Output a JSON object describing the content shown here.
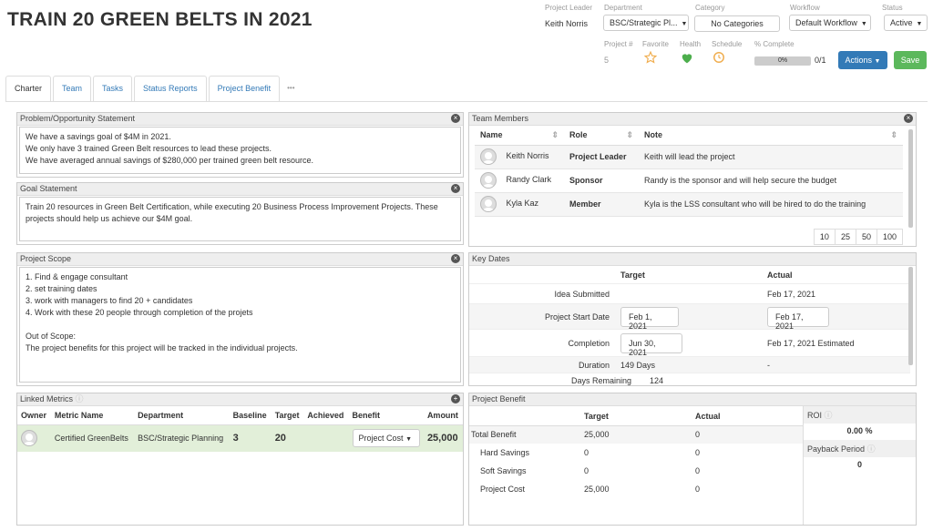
{
  "page": {
    "title": "TRAIN 20 GREEN BELTS IN 2021"
  },
  "header": {
    "project_leader_label": "Project Leader",
    "project_leader": "Keith Norris",
    "department_label": "Department",
    "department": "BSC/Strategic Pl...",
    "category_label": "Category",
    "category": "No Categories",
    "workflow_label": "Workflow",
    "workflow": "Default Workflow",
    "status_label": "Status",
    "status": "Active",
    "project_num_label": "Project #",
    "project_num": "5",
    "favorite_label": "Favorite",
    "health_label": "Health",
    "schedule_label": "Schedule",
    "pct_complete_label": "% Complete",
    "pct_complete": "0%",
    "pct_complete_value": 0,
    "tasks_count": "0/1",
    "actions_label": "Actions",
    "save_label": "Save",
    "colors": {
      "health": "#4cae4c",
      "schedule": "#f0ad4e",
      "favorite": "#f0ad4e",
      "actions": "#337ab7",
      "save": "#5cb85c"
    }
  },
  "tabs": [
    {
      "label": "Charter",
      "active": true
    },
    {
      "label": "Team"
    },
    {
      "label": "Tasks"
    },
    {
      "label": "Status Reports"
    },
    {
      "label": "Project Benefit"
    },
    {
      "label": "•••"
    }
  ],
  "problem": {
    "title": "Problem/Opportunity Statement",
    "lines": [
      "We have a savings goal of $4M in 2021.",
      "We only have 3 trained Green Belt resources to lead these projects.",
      "We have averaged annual savings of $280,000 per trained green belt resource."
    ]
  },
  "goal": {
    "title": "Goal Statement",
    "lines": [
      "Train 20 resources in Green Belt Certification, while executing 20 Business Process Improvement Projects.  These",
      "projects should help us achieve our $4M goal."
    ]
  },
  "scope": {
    "title": "Project Scope",
    "lines": [
      "1. Find & engage consultant",
      "2. set training dates",
      "3. work with managers to find 20 + candidates",
      "4. Work with these 20 people through completion of the projets",
      "",
      "Out of Scope:",
      "The project benefits for this project will be tracked in the individual projects."
    ]
  },
  "team": {
    "title": "Team Members",
    "headers": {
      "name": "Name",
      "role": "Role",
      "note": "Note"
    },
    "rows": [
      {
        "name": "Keith Norris",
        "role": "Project Leader",
        "note": "Keith will lead the project"
      },
      {
        "name": "Randy Clark",
        "role": "Sponsor",
        "note": "Randy is the sponsor and will help secure the budget"
      },
      {
        "name": "Kyla Kaz",
        "role": "Member",
        "note": "Kyla is the LSS consultant who will be hired to do the training"
      }
    ],
    "page_sizes": [
      "10",
      "25",
      "50",
      "100"
    ]
  },
  "key_dates": {
    "title": "Key Dates",
    "target_label": "Target",
    "actual_label": "Actual",
    "idea_label": "Idea Submitted",
    "idea_actual": "Feb 17, 2021",
    "start_label": "Project Start Date",
    "start_target": "Feb 1, 2021",
    "start_actual": "Feb 17, 2021",
    "completion_label": "Completion",
    "completion_target": "Jun 30, 2021",
    "completion_actual": "Feb 17, 2021 Estimated",
    "duration_label": "Duration",
    "duration": "149 Days",
    "duration_actual": "-",
    "remaining_label": "Days Remaining",
    "remaining": "124"
  },
  "linked_metrics": {
    "title": "Linked Metrics",
    "headers": [
      "Owner",
      "Metric Name",
      "Department",
      "Baseline",
      "Target",
      "Achieved",
      "Benefit",
      "Amount"
    ],
    "row": {
      "metric": "Certified GreenBelts",
      "department": "BSC/Strategic Planning",
      "baseline": "3",
      "target": "20",
      "achieved": "",
      "benefit": "Project Cost",
      "amount": "25,000"
    }
  },
  "project_benefit": {
    "title": "Project Benefit",
    "target_label": "Target",
    "actual_label": "Actual",
    "rows": [
      {
        "label": "Total Benefit",
        "target": "25,000",
        "actual": "0"
      },
      {
        "label": "Hard Savings",
        "target": "0",
        "actual": "0"
      },
      {
        "label": "Soft Savings",
        "target": "0",
        "actual": "0"
      },
      {
        "label": "Project Cost",
        "target": "25,000",
        "actual": "0"
      }
    ],
    "roi_label": "ROI",
    "roi": "0.00 %",
    "payback_label": "Payback Period",
    "payback": "0"
  }
}
